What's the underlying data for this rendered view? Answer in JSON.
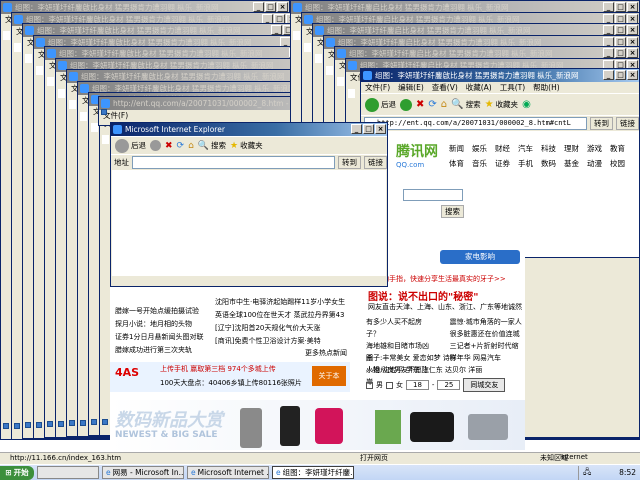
{
  "ie_title_short": "Microsoft Internet Explorer",
  "ie_title_url": "http://ent.qq.com/a/20071031/000002_8.htm - Microsoft...",
  "news_title": "组图：李妍瑾圩纤鏖啟比身材 猛男摄肯力遭羽翱 枞乐_新浪网",
  "news_title_right": "组图：李妍瑾圩纤鏖启比身材 猛男摄肯力遭羽翱 枞乐_新浪网",
  "menu": [
    "文件(F)",
    "编辑(E)",
    "查看(V)",
    "收藏(A)",
    "工具(T)",
    "帮助(H)"
  ],
  "toolbar": {
    "back": "后退",
    "search": "搜索",
    "favorites": "收藏夹"
  },
  "address": {
    "label": "地址",
    "url_short": "http://ent.qq.com/a/20071031/000002_8.htm",
    "url_rect": "http://ent.qq.com/a/20071031/000002_8.htm#cntL",
    "go": "转到",
    "links": "链接"
  },
  "status_bar": {
    "text": "http://11.166.cn/index_163.htm",
    "done_left": "打开网页",
    "zone": "未知区域"
  },
  "qq": {
    "logo_text": "腾讯网",
    "logo_sub": "QQ.com",
    "nav_row1": [
      "新闻",
      "娱乐",
      "财经",
      "汽车",
      "科技",
      "理财",
      "游戏",
      "教育"
    ],
    "nav_row2": [
      "体育",
      "音乐",
      "证券",
      "手机",
      "数码",
      "基金",
      "动漫",
      "校园"
    ],
    "search_btn": "搜索",
    "ad_banner": "家电影响",
    "promo_text": "舞动手指，快速分享生活最真实的牙子>>",
    "feature_title": "图说：说不出口的\"秘密\"",
    "feature_sub": "网友直击天津、上海、山东、浙江、广东等地诚然",
    "news_col1": [
      "有多少人买不起房子？",
      "海地雄和目睹市场凶杀",
      "小姐从良男友不愿上岸"
    ],
    "news_col2": [
      "震惊·城市角落的一家人",
      "很多脏惠还在价值连城",
      "三记者+片折射时代缩影"
    ],
    "fields_row": "圈子:丰常美女 爱恋如梦 诗咩年华 网易汽车",
    "people_row": "人物:沈宏平 学东 陈仁东 达贝尔 洋丽",
    "gender_male": "男",
    "gender_female": "女",
    "age_from": "18",
    "age_to": "25",
    "friend_btn": "同城交友"
  },
  "sina": {
    "left_links": [
      "腊嫁一号开始点缓拍摄试验",
      "探月小说：地月相的头物",
      "证券1分日月悬新闻头图对联",
      "腊嫁成功进行第三次夹轨"
    ],
    "right_links": [
      "沈阳市中生·电驿济起始踢样11岁小学女生",
      "英语全球100位在世天才 蒸武拉丹界第43",
      "[辽宁]沈阳首20天规化气价大天涨",
      "[商讯]免费个性卫浴设计方案·美特"
    ],
    "more": "更多热点新闻",
    "sms_line": "上传手机 赢取第三档 974个多城上传",
    "upload_line": "100天大盘点：40406乡镇上传80116张照片",
    "upload_btn": "关于本",
    "digital_banner": "数码新品大赏",
    "digital_sub": "NEWEST & BIG SALE",
    "logo_text": "4AS"
  },
  "taskbar": {
    "start": "开始",
    "tasks": [
      "网易 - Microsoft In...",
      "Microsoft Internet ...",
      "组图：李妍瑾圩纤鏖..."
    ],
    "tray_net": "Internet",
    "clock": "8:52"
  },
  "colors": {
    "titlebar": "#0a246a",
    "qq_green": "#5aa82a",
    "sina_red": "#cc0000"
  }
}
